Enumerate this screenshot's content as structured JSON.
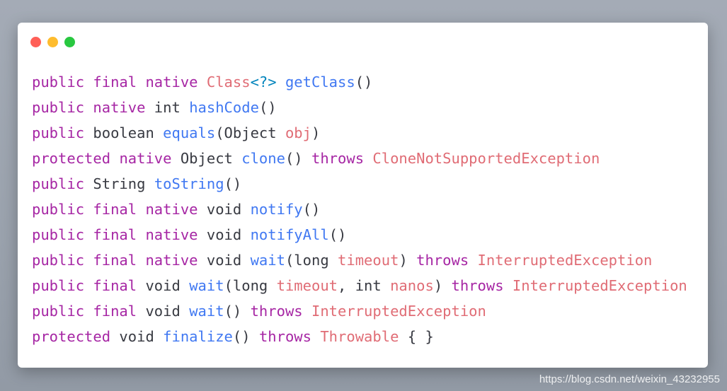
{
  "window": {
    "controls": [
      {
        "name": "close-control",
        "color": "#ff5f57"
      },
      {
        "name": "minimize-control",
        "color": "#febc2e"
      },
      {
        "name": "maximize-control",
        "color": "#28c840"
      }
    ]
  },
  "code_lines": [
    [
      {
        "t": "keyword",
        "v": "public"
      },
      {
        "t": "plain",
        "v": " "
      },
      {
        "t": "keyword",
        "v": "final"
      },
      {
        "t": "plain",
        "v": " "
      },
      {
        "t": "keyword",
        "v": "native"
      },
      {
        "t": "plain",
        "v": " "
      },
      {
        "t": "type",
        "v": "Class"
      },
      {
        "t": "generic",
        "v": "<?>"
      },
      {
        "t": "plain",
        "v": " "
      },
      {
        "t": "method",
        "v": "getClass"
      },
      {
        "t": "punct",
        "v": "()"
      }
    ],
    [
      {
        "t": "keyword",
        "v": "public"
      },
      {
        "t": "plain",
        "v": " "
      },
      {
        "t": "keyword",
        "v": "native"
      },
      {
        "t": "plain",
        "v": " int "
      },
      {
        "t": "method",
        "v": "hashCode"
      },
      {
        "t": "punct",
        "v": "()"
      }
    ],
    [
      {
        "t": "keyword",
        "v": "public"
      },
      {
        "t": "plain",
        "v": " boolean "
      },
      {
        "t": "method",
        "v": "equals"
      },
      {
        "t": "punct",
        "v": "(Object "
      },
      {
        "t": "param",
        "v": "obj"
      },
      {
        "t": "punct",
        "v": ")"
      }
    ],
    [
      {
        "t": "keyword",
        "v": "protected"
      },
      {
        "t": "plain",
        "v": " "
      },
      {
        "t": "keyword",
        "v": "native"
      },
      {
        "t": "plain",
        "v": " Object "
      },
      {
        "t": "method",
        "v": "clone"
      },
      {
        "t": "punct",
        "v": "() "
      },
      {
        "t": "keyword",
        "v": "throws"
      },
      {
        "t": "plain",
        "v": " "
      },
      {
        "t": "type",
        "v": "CloneNotSupportedException"
      }
    ],
    [
      {
        "t": "keyword",
        "v": "public"
      },
      {
        "t": "plain",
        "v": " String "
      },
      {
        "t": "method",
        "v": "toString"
      },
      {
        "t": "punct",
        "v": "()"
      }
    ],
    [
      {
        "t": "keyword",
        "v": "public"
      },
      {
        "t": "plain",
        "v": " "
      },
      {
        "t": "keyword",
        "v": "final"
      },
      {
        "t": "plain",
        "v": " "
      },
      {
        "t": "keyword",
        "v": "native"
      },
      {
        "t": "plain",
        "v": " void "
      },
      {
        "t": "method",
        "v": "notify"
      },
      {
        "t": "punct",
        "v": "()"
      }
    ],
    [
      {
        "t": "keyword",
        "v": "public"
      },
      {
        "t": "plain",
        "v": " "
      },
      {
        "t": "keyword",
        "v": "final"
      },
      {
        "t": "plain",
        "v": " "
      },
      {
        "t": "keyword",
        "v": "native"
      },
      {
        "t": "plain",
        "v": " void "
      },
      {
        "t": "method",
        "v": "notifyAll"
      },
      {
        "t": "punct",
        "v": "()"
      }
    ],
    [
      {
        "t": "keyword",
        "v": "public"
      },
      {
        "t": "plain",
        "v": " "
      },
      {
        "t": "keyword",
        "v": "final"
      },
      {
        "t": "plain",
        "v": " "
      },
      {
        "t": "keyword",
        "v": "native"
      },
      {
        "t": "plain",
        "v": " void "
      },
      {
        "t": "method",
        "v": "wait"
      },
      {
        "t": "punct",
        "v": "(long "
      },
      {
        "t": "param",
        "v": "timeout"
      },
      {
        "t": "punct",
        "v": ") "
      },
      {
        "t": "keyword",
        "v": "throws"
      },
      {
        "t": "plain",
        "v": " "
      },
      {
        "t": "type",
        "v": "InterruptedException"
      }
    ],
    [
      {
        "t": "keyword",
        "v": "public"
      },
      {
        "t": "plain",
        "v": " "
      },
      {
        "t": "keyword",
        "v": "final"
      },
      {
        "t": "plain",
        "v": " void "
      },
      {
        "t": "method",
        "v": "wait"
      },
      {
        "t": "punct",
        "v": "(long "
      },
      {
        "t": "param",
        "v": "timeout"
      },
      {
        "t": "punct",
        "v": ", int "
      },
      {
        "t": "param",
        "v": "nanos"
      },
      {
        "t": "punct",
        "v": ") "
      },
      {
        "t": "keyword",
        "v": "throws"
      },
      {
        "t": "plain",
        "v": " "
      },
      {
        "t": "type",
        "v": "InterruptedException"
      }
    ],
    [
      {
        "t": "keyword",
        "v": "public"
      },
      {
        "t": "plain",
        "v": " "
      },
      {
        "t": "keyword",
        "v": "final"
      },
      {
        "t": "plain",
        "v": " void "
      },
      {
        "t": "method",
        "v": "wait"
      },
      {
        "t": "punct",
        "v": "() "
      },
      {
        "t": "keyword",
        "v": "throws"
      },
      {
        "t": "plain",
        "v": " "
      },
      {
        "t": "type",
        "v": "InterruptedException"
      }
    ],
    [
      {
        "t": "keyword",
        "v": "protected"
      },
      {
        "t": "plain",
        "v": " void "
      },
      {
        "t": "method",
        "v": "finalize"
      },
      {
        "t": "punct",
        "v": "() "
      },
      {
        "t": "keyword",
        "v": "throws"
      },
      {
        "t": "plain",
        "v": " "
      },
      {
        "t": "type",
        "v": "Throwable"
      },
      {
        "t": "punct",
        "v": " { }"
      }
    ]
  ],
  "watermark": "https://blog.csdn.net/weixin_43232955"
}
